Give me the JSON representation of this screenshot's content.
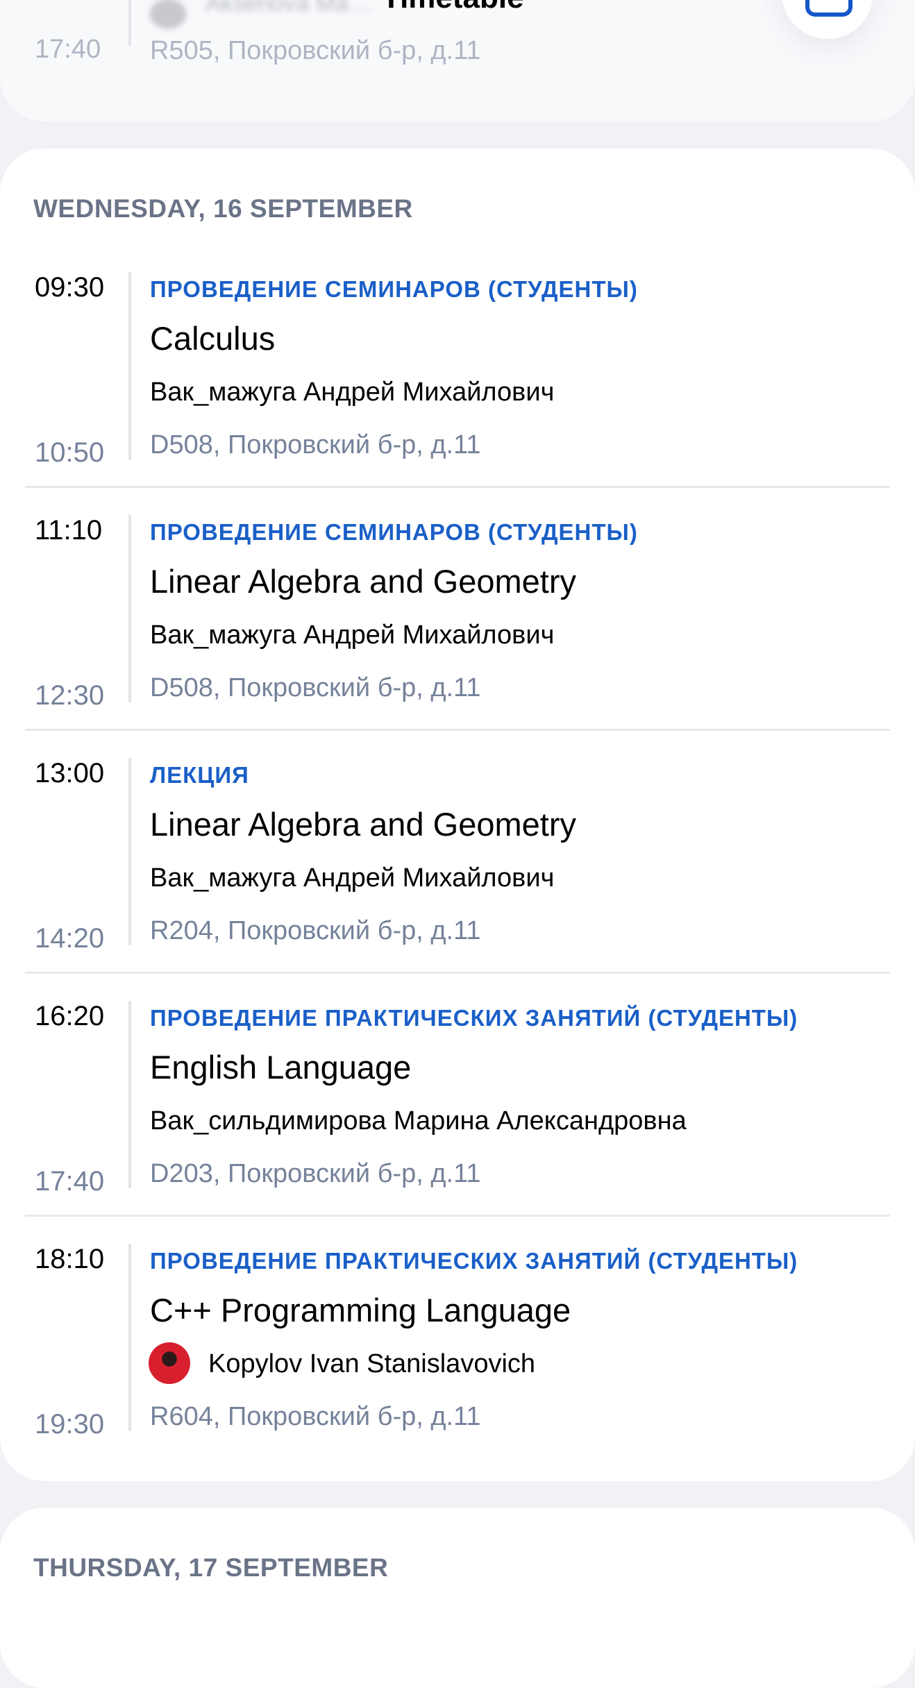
{
  "header": {
    "title": "Timetable",
    "prev_card": {
      "teacher_blurred": "Aksenova Ma…",
      "end_time": "17:40",
      "location": "R505, Покровский б-р, д.11"
    },
    "fab_icon": "calendar-icon"
  },
  "days": [
    {
      "title": "WEDNESDAY, 16 SEPTEMBER",
      "lessons": [
        {
          "start": "09:30",
          "end": "10:50",
          "type": "ПРОВЕДЕНИЕ СЕМИНАРОВ (СТУДЕНТЫ)",
          "subject": "Calculus",
          "teacher": "Вак_мажуга Андрей Михайлович",
          "location": "D508, Покровский б-р, д.11"
        },
        {
          "start": "11:10",
          "end": "12:30",
          "type": "ПРОВЕДЕНИЕ СЕМИНАРОВ (СТУДЕНТЫ)",
          "subject": "Linear Algebra and Geometry",
          "teacher": "Вак_мажуга Андрей Михайлович",
          "location": "D508, Покровский б-р, д.11"
        },
        {
          "start": "13:00",
          "end": "14:20",
          "type": "ЛЕКЦИЯ",
          "subject": "Linear Algebra and Geometry",
          "teacher": "Вак_мажуга Андрей Михайлович",
          "location": "R204, Покровский б-р, д.11"
        },
        {
          "start": "16:20",
          "end": "17:40",
          "type": "ПРОВЕДЕНИЕ ПРАКТИЧЕСКИХ ЗАНЯТИЙ (СТУДЕНТЫ)",
          "subject": "English Language",
          "teacher": "Вак_сильдимирова Марина Александровна",
          "location": "D203, Покровский б-р, д.11"
        },
        {
          "start": "18:10",
          "end": "19:30",
          "type": "ПРОВЕДЕНИЕ ПРАКТИЧЕСКИХ ЗАНЯТИЙ (СТУДЕНТЫ)",
          "subject": "C++ Programming Language",
          "teacher": "Kopylov Ivan Stanislavovich",
          "location": "R604, Покровский б-р, д.11"
        }
      ]
    },
    {
      "title": "THURSDAY, 17 SEPTEMBER",
      "lessons": []
    }
  ],
  "colors": {
    "background": "#f1f2f6",
    "card": "#ffffff",
    "accent": "#1a5fc8",
    "muted": "#75829a",
    "header_text": "#6a7387"
  }
}
